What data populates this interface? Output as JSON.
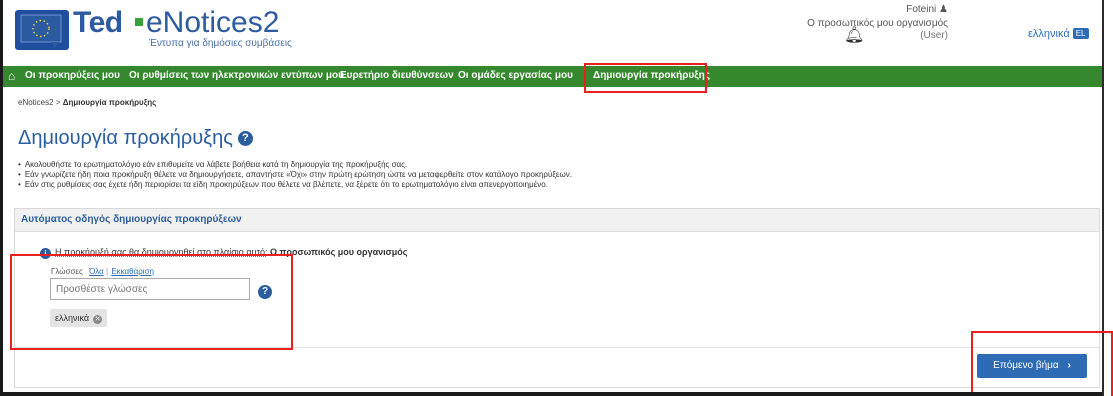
{
  "header": {
    "logo_ted": "Ted",
    "logo_enotices": "eNotices2",
    "logo_subtitle": "Έντυπα για δημόσιες συμβάσεις",
    "user_name": "Foteini",
    "user_org": "Ο προσωπικός μου οργανισμός",
    "user_role": "(User)",
    "language": "ελληνικά",
    "language_code": "EL"
  },
  "nav": {
    "items": [
      "Οι προκηρύξεις μου",
      "Οι ρυθμίσεις των ηλεκτρονικών εντύπων μου",
      "Ευρετήριο διευθύνσεων",
      "Οι ομάδες εργασίας μου",
      "Δημιουργία προκήρυξης"
    ]
  },
  "breadcrumb": {
    "root": "eNotices2",
    "separator": ">",
    "current": "Δημιουργία προκήρυξης"
  },
  "page": {
    "title": "Δημιουργία προκήρυξης",
    "help_glyph": "?",
    "bullets": [
      "Ακολουθήστε το ερωτηματολόγιο εάν επιθυμείτε να λάβετε βοήθεια κατά τη δημιουργία της προκήρυξής σας.",
      "Εάν γνωρίζετε ήδη ποια προκήρυξη θέλετε να δημιουργήσετε, απαντήστε «Όχι» στην πρώτη ερώτηση ώστε να μεταφερθείτε στον κατάλογο προκηρύξεων.",
      "Εάν στις ρυθμίσεις σας έχετε ήδη περιορίσει τα είδη προκηρύξεων που θέλετε να βλέπετε, να ξέρετε ότι το ερωτηματολόγιο είναι απενεργοποιημένο."
    ]
  },
  "wizard": {
    "header": "Αυτόματος οδηγός δημιουργίας προκηρύξεων",
    "info_text": "Η προκήρυξή σας θα δημιουργηθεί στο πλαίσιο αυτό:",
    "info_org": "Ο προσωπικός μου οργανισμός",
    "languages_label": "Γλώσσες",
    "all_link": "Όλα",
    "clear_link": "Εκκαθάριση",
    "languages_placeholder": "Προσθέστε γλώσσες",
    "selected_language": "ελληνικά",
    "next_button": "Επόμενο βήμα",
    "next_chevron": "›"
  },
  "colors": {
    "nav_green": "#35882d",
    "brand_blue": "#2b5e9f",
    "highlight_red": "#e8211c"
  }
}
